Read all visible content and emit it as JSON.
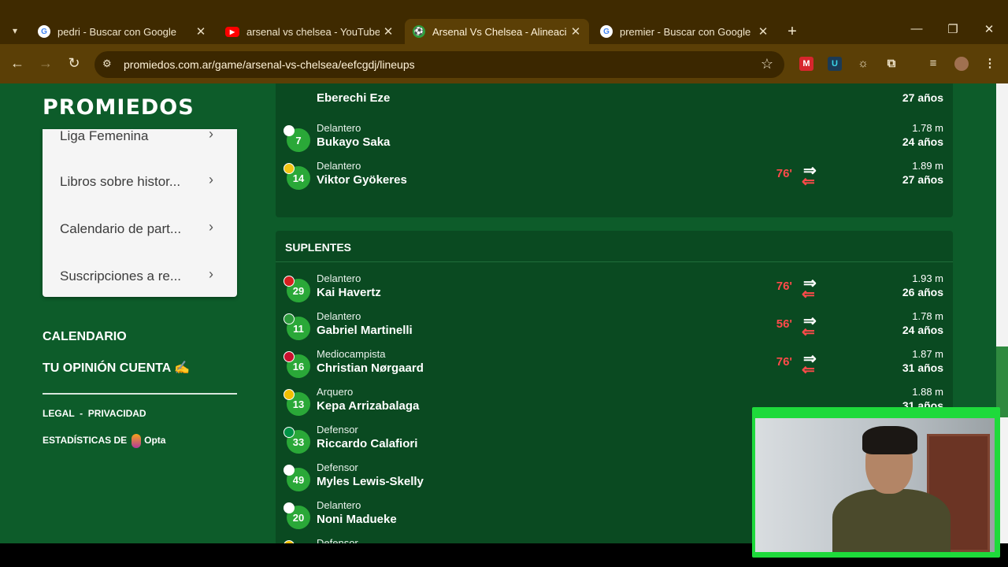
{
  "browser": {
    "tabs": [
      {
        "title": "pedri - Buscar con Google",
        "favicon": "google-icon",
        "active": false
      },
      {
        "title": "arsenal vs chelsea - YouTube",
        "favicon": "youtube-icon",
        "active": false
      },
      {
        "title": "Arsenal Vs Chelsea - Alineacion",
        "favicon": "promiedos-icon",
        "active": true
      },
      {
        "title": "premier - Buscar con Google",
        "favicon": "google-icon",
        "active": false
      }
    ],
    "url": "promiedos.com.ar/game/arsenal-vs-chelsea/eefcgdj/lineups"
  },
  "site": {
    "logo": "PROMIEDOS",
    "menu_items": [
      {
        "label": "Liga Femenina"
      },
      {
        "label": "Libros sobre histor..."
      },
      {
        "label": "Calendario de part..."
      },
      {
        "label": "Suscripciones a re..."
      }
    ],
    "sidebar": {
      "calendario": "CALENDARIO",
      "opinion": "TU OPINIÓN CUENTA ✍",
      "legal": "LEGAL",
      "sep": "-",
      "privacidad": "PRIVACIDAD",
      "stats_prefix": "ESTADÍSTICAS DE",
      "stats_brand": "Opta"
    }
  },
  "lineup": {
    "partial_top": {
      "name": "Eberechi Eze",
      "age": "27 años"
    },
    "starters_tail": [
      {
        "number": "7",
        "position": "Delantero",
        "name": "Bukayo Saka",
        "height": "1.78 m",
        "age": "24 años",
        "minute": "",
        "flag_color": "#ffffff"
      },
      {
        "number": "14",
        "position": "Delantero",
        "name": "Viktor Gyökeres",
        "height": "1.89 m",
        "age": "27 años",
        "minute": "76'",
        "flag_color": "#f3c413"
      }
    ],
    "subs_header": "SUPLENTES",
    "subs": [
      {
        "number": "29",
        "position": "Delantero",
        "name": "Kai Havertz",
        "height": "1.93 m",
        "age": "26 años",
        "minute": "76'",
        "flag_color": "#d61f1f"
      },
      {
        "number": "11",
        "position": "Delantero",
        "name": "Gabriel Martinelli",
        "height": "1.78 m",
        "age": "24 años",
        "minute": "56'",
        "flag_color": "#2c9b3c"
      },
      {
        "number": "16",
        "position": "Mediocampista",
        "name": "Christian Nørgaard",
        "height": "1.87 m",
        "age": "31 años",
        "minute": "76'",
        "flag_color": "#c8102e"
      },
      {
        "number": "13",
        "position": "Arquero",
        "name": "Kepa Arrizabalaga",
        "height": "1.88 m",
        "age": "31 años",
        "minute": "",
        "flag_color": "#f1bf00"
      },
      {
        "number": "33",
        "position": "Defensor",
        "name": "Riccardo Calafiori",
        "height": "",
        "age": "",
        "minute": "",
        "flag_color": "#009246"
      },
      {
        "number": "49",
        "position": "Defensor",
        "name": "Myles Lewis-Skelly",
        "height": "",
        "age": "",
        "minute": "",
        "flag_color": "#ffffff"
      },
      {
        "number": "20",
        "position": "Delantero",
        "name": "Noni Madueke",
        "height": "",
        "age": "",
        "minute": "",
        "flag_color": "#ffffff"
      },
      {
        "number": "",
        "position": "Defensor",
        "name": "",
        "height": "",
        "age": "",
        "minute": "",
        "flag_color": "#f1bf00"
      }
    ]
  }
}
